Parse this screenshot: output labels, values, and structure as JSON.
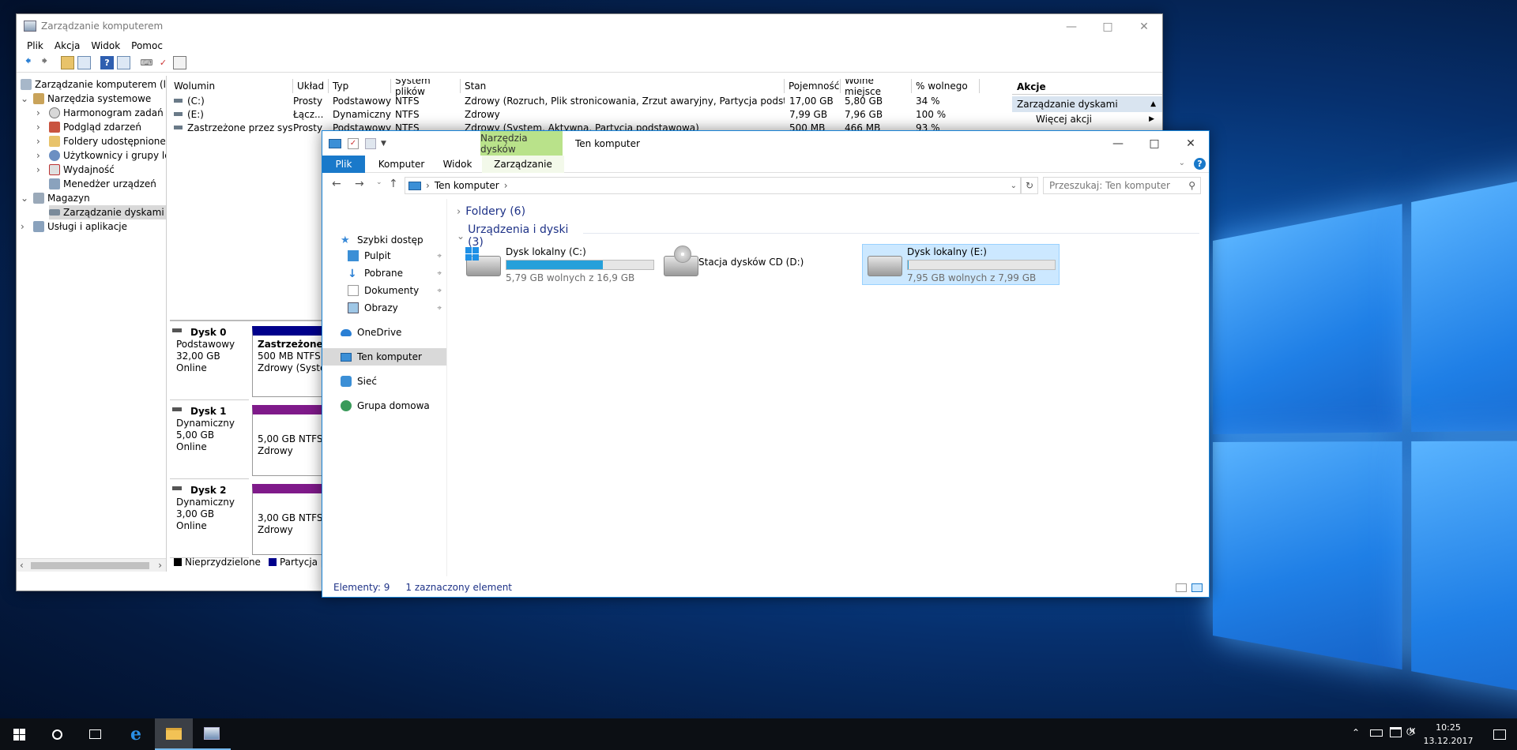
{
  "compmgmt": {
    "title": "Zarządzanie komputerem",
    "menu": [
      "Plik",
      "Akcja",
      "Widok",
      "Pomoc"
    ],
    "tree": [
      {
        "label": "Zarządzanie komputerem (loka",
        "level": 0
      },
      {
        "label": "Narzędzia systemowe",
        "level": 1
      },
      {
        "label": "Harmonogram zadań",
        "level": 2
      },
      {
        "label": "Podgląd zdarzeń",
        "level": 2
      },
      {
        "label": "Foldery udostępnione",
        "level": 2
      },
      {
        "label": "Użytkownicy i grupy lok",
        "level": 2
      },
      {
        "label": "Wydajność",
        "level": 2
      },
      {
        "label": "Menedżer urządzeń",
        "level": 2
      },
      {
        "label": "Magazyn",
        "level": 1
      },
      {
        "label": "Zarządzanie dyskami",
        "level": 2
      },
      {
        "label": "Usługi i aplikacje",
        "level": 1
      }
    ],
    "columns": [
      "Wolumin",
      "Układ",
      "Typ",
      "System plików",
      "Stan",
      "Pojemność",
      "Wolne miejsce",
      "% wolnego"
    ],
    "rows": [
      [
        "(C:)",
        "Prosty",
        "Podstawowy",
        "NTFS",
        "Zdrowy (Rozruch, Plik stronicowania, Zrzut awaryjny, Partycja podstawowa)",
        "17,00 GB",
        "5,80 GB",
        "34 %"
      ],
      [
        "(E:)",
        "Łącz...",
        "Dynamiczny",
        "NTFS",
        "Zdrowy",
        "7,99 GB",
        "7,96 GB",
        "100 %"
      ],
      [
        "Zastrzeżone przez system",
        "Prosty",
        "Podstawowy",
        "NTFS",
        "Zdrowy (System, Aktywna, Partycja podstawowa)",
        "500 MB",
        "466 MB",
        "93 %"
      ]
    ],
    "disks": [
      {
        "name": "Dysk 0",
        "type": "Podstawowy",
        "size": "32,00 GB",
        "status": "Online",
        "part_title": "Zastrzeżone p",
        "part_size": "500 MB NTFS",
        "part_state": "Zdrowy (Syster"
      },
      {
        "name": "Dysk 1",
        "type": "Dynamiczny",
        "size": "5,00 GB",
        "status": "Online",
        "part_title": "",
        "part_size": "5,00 GB NTFS",
        "part_state": "Zdrowy"
      },
      {
        "name": "Dysk 2",
        "type": "Dynamiczny",
        "size": "3,00 GB",
        "status": "Online",
        "part_title": "",
        "part_size": "3,00 GB NTFS",
        "part_state": "Zdrowy"
      }
    ],
    "legend": [
      "Nieprzydzielone",
      "Partycja pod"
    ],
    "actions": {
      "header": "Akcje",
      "section": "Zarządzanie dyskami",
      "more": "Więcej akcji"
    }
  },
  "explorer": {
    "title": "Ten komputer",
    "context_tab": "Narzędzia dysków",
    "tabs": [
      "Plik",
      "Komputer",
      "Widok",
      "Zarządzanie"
    ],
    "address": "Ten komputer",
    "search_placeholder": "Przeszukaj: Ten komputer",
    "nav": [
      {
        "label": "Szybki dostęp",
        "pin": false
      },
      {
        "label": "Pulpit",
        "pin": true
      },
      {
        "label": "Pobrane",
        "pin": true
      },
      {
        "label": "Dokumenty",
        "pin": true
      },
      {
        "label": "Obrazy",
        "pin": true
      },
      {
        "label": "OneDrive",
        "pin": false
      },
      {
        "label": "Ten komputer",
        "pin": false
      },
      {
        "label": "Sieć",
        "pin": false
      },
      {
        "label": "Grupa domowa",
        "pin": false
      }
    ],
    "groups": {
      "folders": "Foldery (6)",
      "devices": "Urządzenia i dyski (3)"
    },
    "drives": [
      {
        "name": "Dysk lokalny (C:)",
        "free": "5,79 GB wolnych z 16,9 GB",
        "used_fraction": 0.657
      },
      {
        "name": "Stacja dysków CD (D:)",
        "free": "",
        "used_fraction": 0
      },
      {
        "name": "Dysk lokalny (E:)",
        "free": "7,95 GB wolnych z 7,99 GB",
        "used_fraction": 0.005
      }
    ],
    "status": {
      "items": "Elementy: 9",
      "selected": "1 zaznaczony element"
    }
  },
  "taskbar": {
    "time": "10:25",
    "date": "13.12.2017"
  },
  "colors": {
    "accent": "#1883d7",
    "selection": "#cce8ff",
    "drive_bar": "#26a0da",
    "context_tab": "#b9e28a"
  }
}
